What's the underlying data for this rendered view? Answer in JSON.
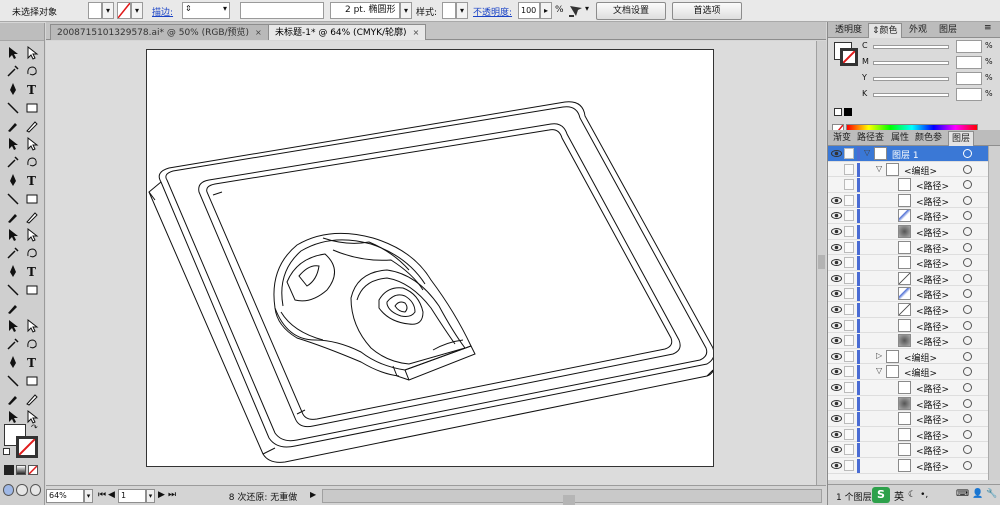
{
  "control_bar": {
    "selection_label": "未选择对象",
    "stroke_link": "描边:",
    "stroke_width": "",
    "brush_label": "2 pt. 椭圆形",
    "style_label": "样式:",
    "opacity_link": "不透明度:",
    "opacity_value": "100",
    "opacity_unit": "%",
    "doc_setup_button": "文档设置",
    "preferences_button": "首选项"
  },
  "document_tabs": [
    {
      "label": "200871510132957​8.ai* @ 50% (RGB/预览)",
      "close": "×"
    },
    {
      "label": "未标题-1* @ 64% (CMYK/轮廓)",
      "close": "×"
    }
  ],
  "status_bar": {
    "zoom": "64%",
    "artboard": "1",
    "status_text": "8 次还原: 无重做"
  },
  "color_panel": {
    "tabs": [
      "透明度",
      "颜色",
      "外观",
      "图层"
    ],
    "active_tab": "颜色",
    "channels": [
      {
        "name": "C",
        "value": "",
        "unit": "%"
      },
      {
        "name": "M",
        "value": "",
        "unit": "%"
      },
      {
        "name": "Y",
        "value": "",
        "unit": "%"
      },
      {
        "name": "K",
        "value": "",
        "unit": "%"
      }
    ]
  },
  "layers_panel": {
    "tabs": [
      "渐变",
      "路径查",
      "属性",
      "颜色参",
      "图层"
    ],
    "active_tab": "图层",
    "rows": [
      {
        "name": "图层 1",
        "depth": 0,
        "expanded": true,
        "selected": true,
        "visible": true,
        "has_arrow": true,
        "thumb": "blank"
      },
      {
        "name": "<编组>",
        "depth": 1,
        "expanded": true,
        "selected": false,
        "visible": false,
        "has_arrow": true,
        "thumb": "blank"
      },
      {
        "name": "<路径>",
        "depth": 2,
        "selected": false,
        "visible": false,
        "has_arrow": false,
        "thumb": "blank"
      },
      {
        "name": "<路径>",
        "depth": 2,
        "selected": false,
        "visible": true,
        "has_arrow": false,
        "thumb": "blank"
      },
      {
        "name": "<路径>",
        "depth": 2,
        "selected": false,
        "visible": true,
        "has_arrow": false,
        "thumb": "stripe"
      },
      {
        "name": "<路径>",
        "depth": 2,
        "selected": false,
        "visible": true,
        "has_arrow": false,
        "thumb": "dark"
      },
      {
        "name": "<路径>",
        "depth": 2,
        "selected": false,
        "visible": true,
        "has_arrow": false,
        "thumb": "blank"
      },
      {
        "name": "<路径>",
        "depth": 2,
        "selected": false,
        "visible": true,
        "has_arrow": false,
        "thumb": "blank"
      },
      {
        "name": "<路径>",
        "depth": 2,
        "selected": false,
        "visible": true,
        "has_arrow": false,
        "thumb": "line"
      },
      {
        "name": "<路径>",
        "depth": 2,
        "selected": false,
        "visible": true,
        "has_arrow": false,
        "thumb": "stripe"
      },
      {
        "name": "<路径>",
        "depth": 2,
        "selected": false,
        "visible": true,
        "has_arrow": false,
        "thumb": "line"
      },
      {
        "name": "<路径>",
        "depth": 2,
        "selected": false,
        "visible": true,
        "has_arrow": false,
        "thumb": "blank"
      },
      {
        "name": "<路径>",
        "depth": 2,
        "selected": false,
        "visible": true,
        "has_arrow": false,
        "thumb": "dark"
      },
      {
        "name": "<编组>",
        "depth": 1,
        "expanded": false,
        "selected": false,
        "visible": true,
        "has_arrow": true,
        "thumb": "blank"
      },
      {
        "name": "<编组>",
        "depth": 1,
        "expanded": true,
        "selected": false,
        "visible": true,
        "has_arrow": true,
        "thumb": "blank"
      },
      {
        "name": "<路径>",
        "depth": 2,
        "selected": false,
        "visible": true,
        "has_arrow": false,
        "thumb": "blank"
      },
      {
        "name": "<路径>",
        "depth": 2,
        "selected": false,
        "visible": true,
        "has_arrow": false,
        "thumb": "dark"
      },
      {
        "name": "<路径>",
        "depth": 2,
        "selected": false,
        "visible": true,
        "has_arrow": false,
        "thumb": "blank"
      },
      {
        "name": "<路径>",
        "depth": 2,
        "selected": false,
        "visible": true,
        "has_arrow": false,
        "thumb": "blank"
      },
      {
        "name": "<路径>",
        "depth": 2,
        "selected": false,
        "visible": true,
        "has_arrow": false,
        "thumb": "blank"
      },
      {
        "name": "<路径>",
        "depth": 2,
        "selected": false,
        "visible": true,
        "has_arrow": false,
        "thumb": "blank"
      }
    ],
    "footer_count": "1 个图层",
    "ime_badge": "S",
    "ime_lang": "英"
  },
  "colors": {
    "accent": "#3a78d6",
    "link": "#1a43c6",
    "layer_bar": "#4a6cd4"
  }
}
